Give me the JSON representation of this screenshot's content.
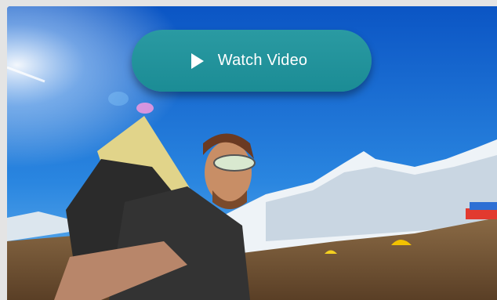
{
  "video": {
    "play_icon": "play-icon",
    "watch_label": "Watch Video",
    "button_color": "#1e9098",
    "sky_color": "#1a6fd0"
  }
}
